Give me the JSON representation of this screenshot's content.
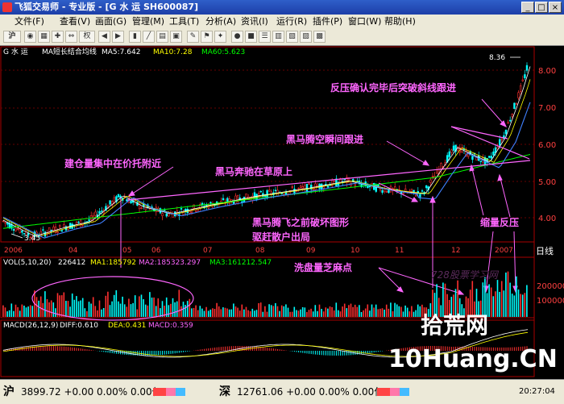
{
  "window": {
    "title": "飞狐交易师 - 专业版 - [G 水 运 SH600087]"
  },
  "menu": [
    "文件(F)",
    "查看(V)",
    "画面(G)",
    "管理(M)",
    "工具(T)",
    "分析(A)",
    "资讯(I)",
    "运行(R)",
    "插件(P)",
    "窗口(W)",
    "帮助(H)"
  ],
  "toolbar": {
    "pinyin_label": "沪",
    "weight_label": "权"
  },
  "price_panel": {
    "header": {
      "stock": "G 水 运",
      "indicator": "MA短长结合均线",
      "ma5": "MA5:7.642",
      "ma10": "MA10:7.28",
      "ma60": "MA60:5.623"
    },
    "y_labels": [
      "8.00",
      "7.00",
      "6.00",
      "5.00",
      "4.00"
    ],
    "high_label": "8.36",
    "low_label": "3.45",
    "x_labels": [
      "2006",
      "04",
      "05",
      "06",
      "07",
      "08",
      "09",
      "10",
      "11",
      "12",
      "2007"
    ],
    "period_label": "日线",
    "colors": {
      "ma5": "#ffffff",
      "ma10": "#ffff00",
      "ma60": "#00ff00",
      "ma_long": "#4080ff",
      "annot": "#ff66ff"
    }
  },
  "annotations": {
    "a1": "反压确认完毕后突破斜线跟进",
    "a2": "黑马腾空瞬间跟进",
    "a3": "建仓量集中在价托附近",
    "a4": "黑马奔驰在草原上",
    "a5": "黑马腾飞之前破坏图形",
    "a6": "驱赶散户出局",
    "a7": "缩量反压",
    "a8": "洗盘量芝麻点"
  },
  "vol_panel": {
    "header": {
      "name": "VOL(5,10,20)",
      "value": "226412",
      "ma1": "MA1:185792",
      "ma2": "MA2:185323.297",
      "ma3": "MA3:161212.547"
    },
    "y_labels": [
      "200000",
      "100000"
    ],
    "watermark": "728股票学习网"
  },
  "macd_panel": {
    "header": {
      "name": "MACD(26,12,9)",
      "diff": "DIFF:0.610",
      "dea": "DEA:0.431",
      "macd": "MACD:0.359"
    }
  },
  "logo": {
    "line1": "拾荒网",
    "line2": "10Huang.CN"
  },
  "status": {
    "sh_label": "沪",
    "sh_text": "3899.72 +0.00 0.00% 0.00亿",
    "sz_label": "深",
    "sz_text": "12761.06 +0.00 0.00% 0.00亿",
    "time": "20:27:04"
  }
}
